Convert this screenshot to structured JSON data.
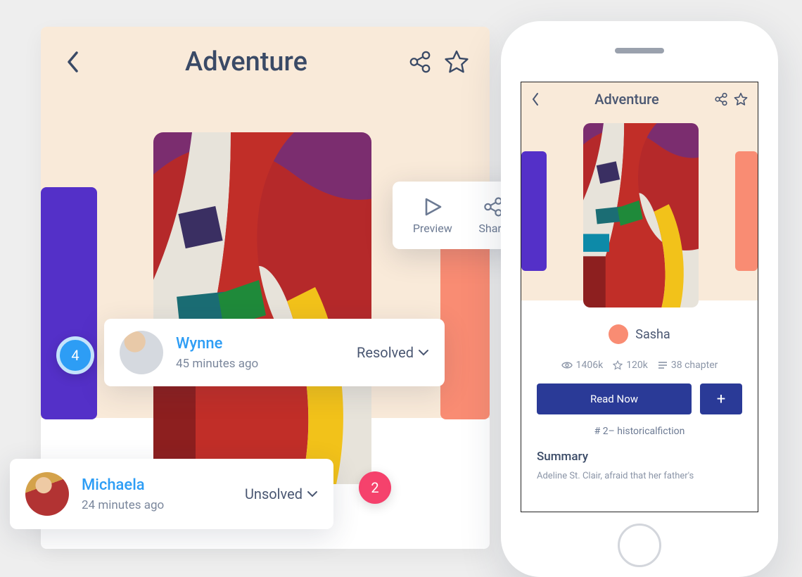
{
  "main": {
    "title": "Adventure"
  },
  "popover": {
    "preview": "Preview",
    "share": "Share"
  },
  "comments": {
    "wynne": {
      "name": "Wynne",
      "time": "45 minutes ago",
      "status": "Resolved"
    },
    "michaela": {
      "name": "Michaela",
      "time": "24 minutes ago",
      "status": "Unsolved"
    }
  },
  "badges": {
    "blue": "4",
    "pink": "2"
  },
  "phone": {
    "title": "Adventure",
    "author": "Sasha",
    "stats": {
      "views": "1406k",
      "stars": "120k",
      "chapters": "38 chapter"
    },
    "cta": "Read Now",
    "tag": "# 2– historicalfiction",
    "summary_title": "Summary",
    "summary_text": "Adeline St. Clair, afraid that her father's"
  },
  "colors": {
    "purple": "#5430c8",
    "coral": "#f98c73",
    "blue": "#2d9df5",
    "navy": "#2a3a97",
    "pink": "#f5426c"
  }
}
